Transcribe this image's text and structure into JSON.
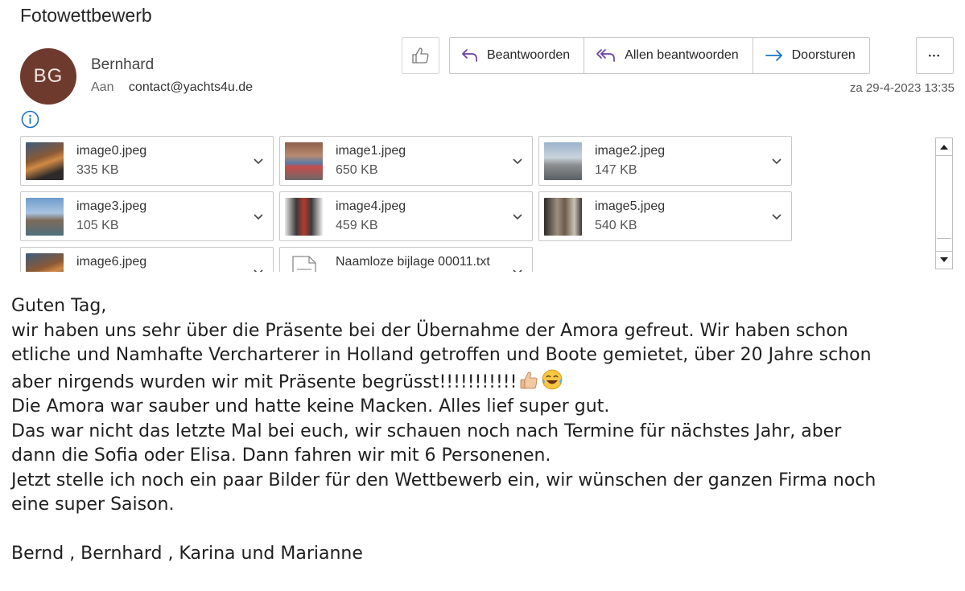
{
  "email": {
    "subject": "Fotowettbewerb",
    "sender": {
      "initials": "BG",
      "name": "Bernhard",
      "avatar_color": "#6e3a2e"
    },
    "to_label": "Aan",
    "to_address": "contact@yachts4u.de",
    "datetime": "za 29-4-2023 13:35"
  },
  "toolbar": {
    "like_icon": "thumbs-up-icon",
    "reply_label": "Beantwoorden",
    "reply_all_label": "Allen beantwoorden",
    "forward_label": "Doorsturen",
    "more_icon": "more-icon",
    "more_label": "•••",
    "accent": "#6b3fa0",
    "forward_accent": "#1a73c8"
  },
  "attachments": [
    {
      "name": "image0.jpeg",
      "size": "335 KB",
      "type": "image"
    },
    {
      "name": "image1.jpeg",
      "size": "650 KB",
      "type": "image"
    },
    {
      "name": "image2.jpeg",
      "size": "147 KB",
      "type": "image"
    },
    {
      "name": "image3.jpeg",
      "size": "105 KB",
      "type": "image"
    },
    {
      "name": "image4.jpeg",
      "size": "459 KB",
      "type": "image"
    },
    {
      "name": "image5.jpeg",
      "size": "540 KB",
      "type": "image"
    },
    {
      "name": "image6.jpeg",
      "size": "",
      "type": "image"
    },
    {
      "name": "Naamloze bijlage 00011.txt",
      "size": "",
      "type": "text"
    }
  ],
  "body": {
    "greeting": "Guten Tag,",
    "line1": "wir haben uns sehr über die Präsente bei der Übernahme der Amora gefreut. Wir haben schon",
    "line2": "etliche und Namhafte Vercharterer in Holland getroffen und Boote gemietet, über 20 Jahre schon",
    "line3": "aber nirgends wurden wir mit Präsente begrüsst!!!!!!!!!!!",
    "line4": "Die Amora war sauber und hatte keine Macken. Alles lief super gut.",
    "line5": "Das war nicht das letzte Mal bei euch, wir schauen noch nach Termine für nächstes Jahr, aber",
    "line6": "dann die Sofia oder Elisa. Dann fahren wir mit 6 Personenen.",
    "line7": "Jetzt stelle ich noch ein paar Bilder für den Wettbewerb ein, wir wünschen der ganzen Firma noch",
    "line8": "eine super Saison.",
    "signature": "Bernd , Bernhard , Karina und Marianne",
    "emojis": [
      "thumbs-up-emoji",
      "laughing-tears-emoji"
    ]
  }
}
